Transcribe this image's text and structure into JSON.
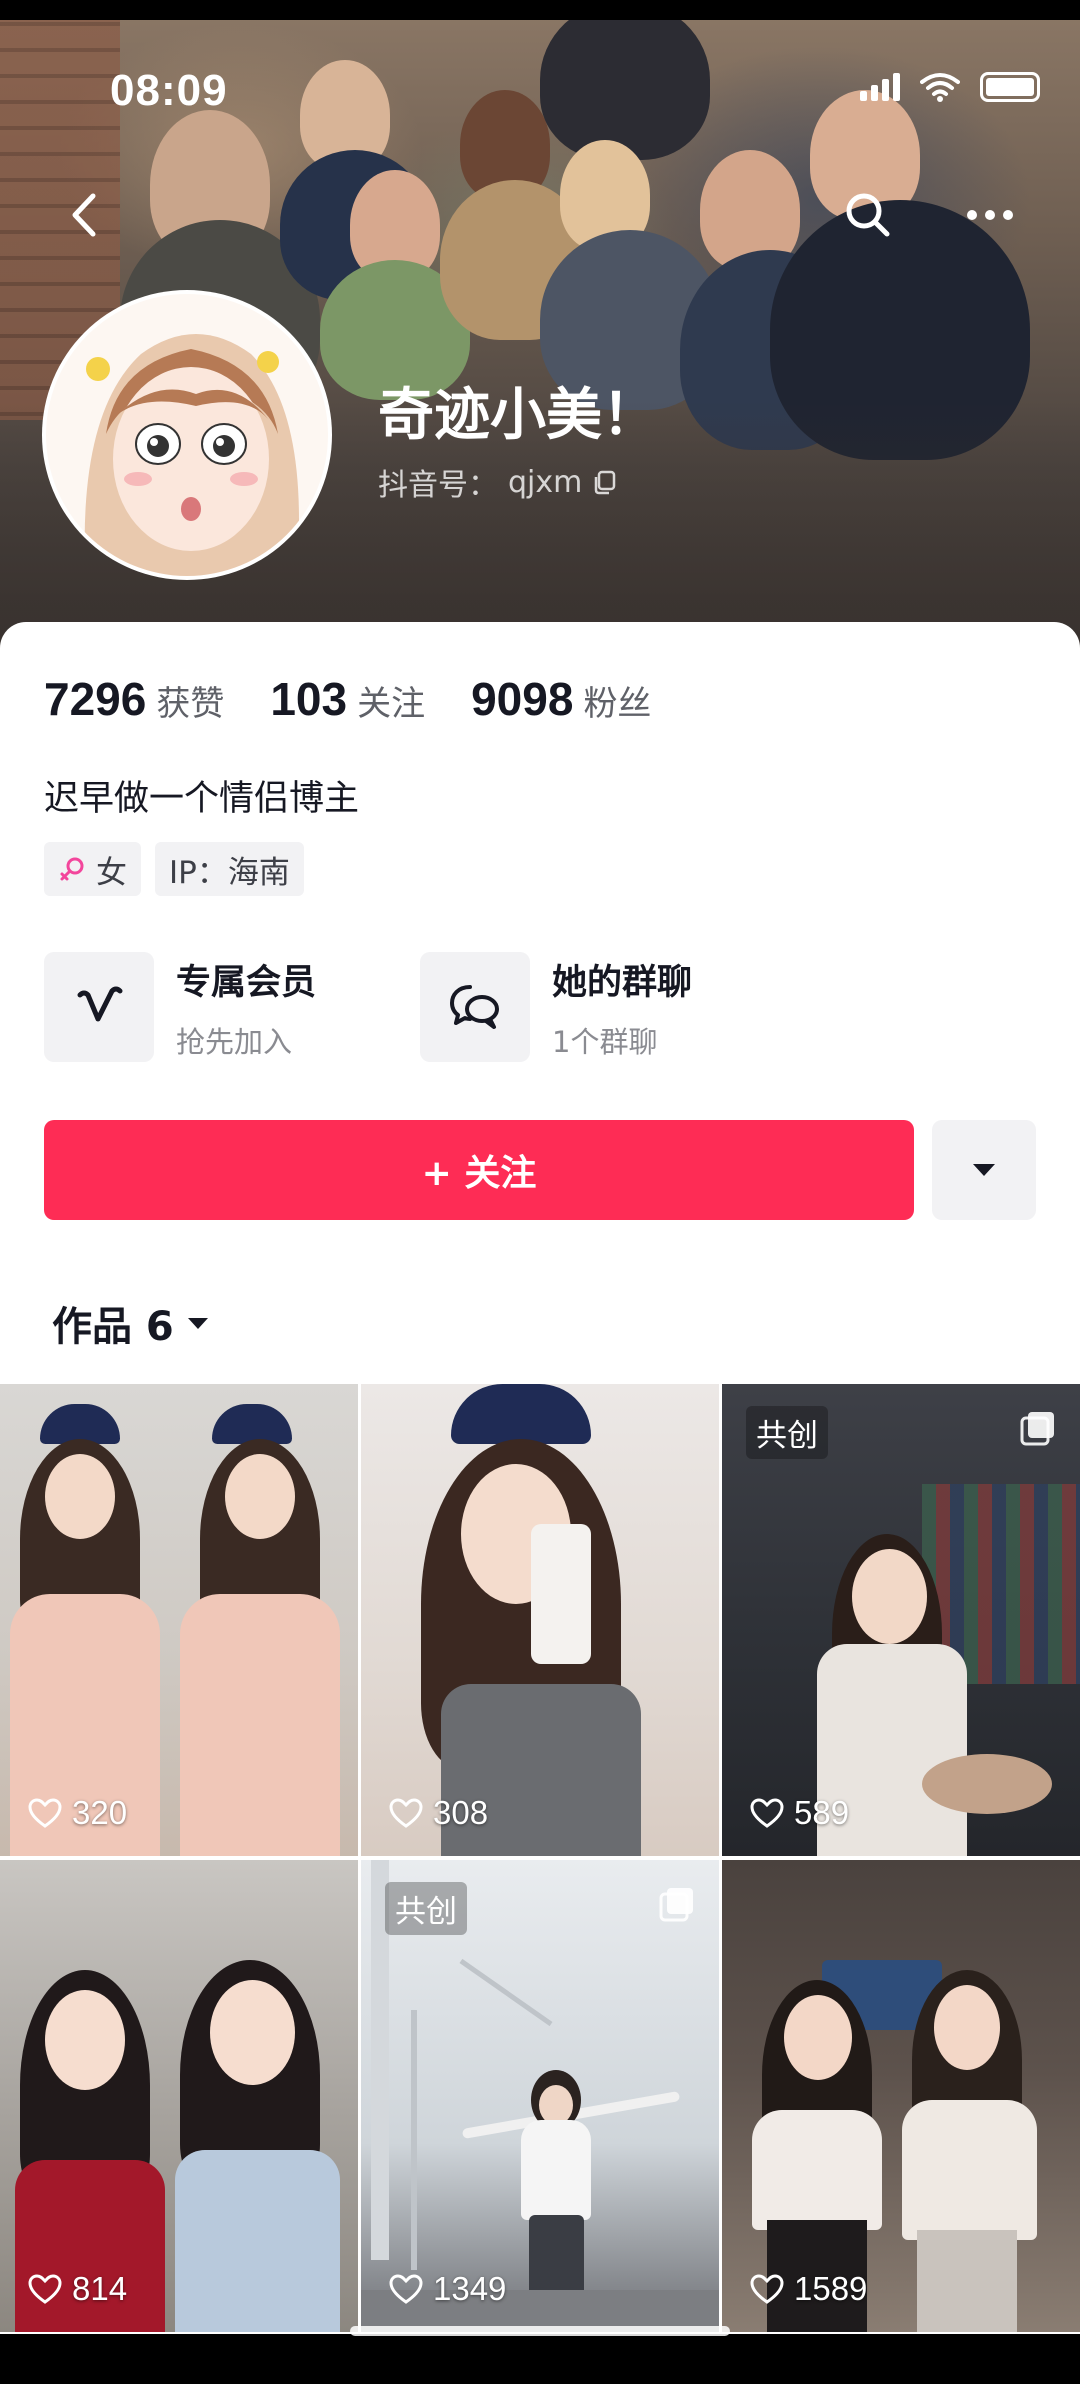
{
  "status_bar": {
    "time": "08:09"
  },
  "profile": {
    "name": "奇迹小美！",
    "id_label": "抖音号：",
    "id_value": "qjxm"
  },
  "stats": [
    {
      "value": "7296",
      "label": "获赞"
    },
    {
      "value": "103",
      "label": "关注"
    },
    {
      "value": "9098",
      "label": "粉丝"
    }
  ],
  "bio": "迟早做一个情侣博主",
  "tags": {
    "gender": "女",
    "ip": "IP：海南"
  },
  "features": [
    {
      "title": "专属会员",
      "sub": "抢先加入",
      "icon": "vip-v-icon"
    },
    {
      "title": "她的群聊",
      "sub": "1个群聊",
      "icon": "group-chat-icon"
    }
  ],
  "follow_button": "+ 关注",
  "works_tab": "作品 6",
  "videos": [
    {
      "likes": "320",
      "badge": "",
      "multi": false
    },
    {
      "likes": "308",
      "badge": "",
      "multi": false
    },
    {
      "likes": "589",
      "badge": "共创",
      "multi": true
    },
    {
      "likes": "814",
      "badge": "",
      "multi": false
    },
    {
      "likes": "1349",
      "badge": "共创",
      "multi": true
    },
    {
      "likes": "1589",
      "badge": "",
      "multi": false
    }
  ],
  "colors": {
    "accent": "#fe2c55",
    "text": "#161823",
    "secondary": "#8a8b91"
  }
}
